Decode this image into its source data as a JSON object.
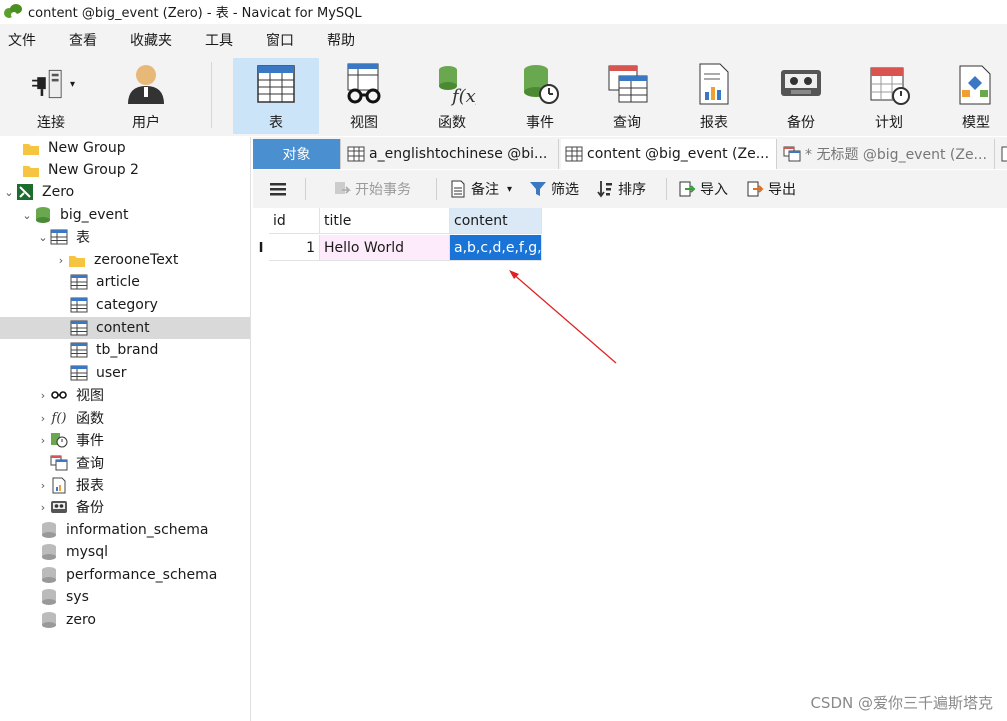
{
  "window": {
    "title": "content @big_event (Zero) - 表 - Navicat for MySQL"
  },
  "menu": [
    "文件",
    "查看",
    "收藏夹",
    "工具",
    "窗口",
    "帮助"
  ],
  "toolbar": {
    "connect": "连接",
    "user": "用户",
    "table": "表",
    "view": "视图",
    "function": "函数",
    "event": "事件",
    "query": "查询",
    "report": "报表",
    "backup": "备份",
    "schedule": "计划",
    "model": "模型"
  },
  "sidebar": {
    "group1": "New Group",
    "group2": "New Group 2",
    "connection": "Zero",
    "database": "big_event",
    "tables_node": "表",
    "tables": [
      "zerooneText",
      "article",
      "category",
      "content",
      "tb_brand",
      "user"
    ],
    "selected_table": "content",
    "views": "视图",
    "functions": "函数",
    "events": "事件",
    "queries": "查询",
    "reports": "报表",
    "backups": "备份",
    "other_dbs": [
      "information_schema",
      "mysql",
      "performance_schema",
      "sys",
      "zero"
    ]
  },
  "tabs": {
    "objects": "对象",
    "tab1": "a_englishtochinese @bi...",
    "tab2": "content @big_event (Ze...",
    "tab3": "* 无标题 @big_event (Ze..."
  },
  "subtoolbar": {
    "menu_icon": "hamburger-icon",
    "begin_transaction": "开始事务",
    "comment": "备注",
    "filter": "筛选",
    "sort": "排序",
    "import": "导入",
    "export": "导出"
  },
  "grid": {
    "columns": [
      "id",
      "title",
      "content"
    ],
    "rows": [
      {
        "id": "1",
        "title": "Hello World",
        "content": "a,b,c,d,e,f,g,"
      }
    ],
    "row_marker": "I"
  },
  "watermark": "CSDN @爱你三千遍斯塔克",
  "colors": {
    "accent": "#4a90d0",
    "selection": "#1a73d6",
    "annotation": "#e02020"
  }
}
